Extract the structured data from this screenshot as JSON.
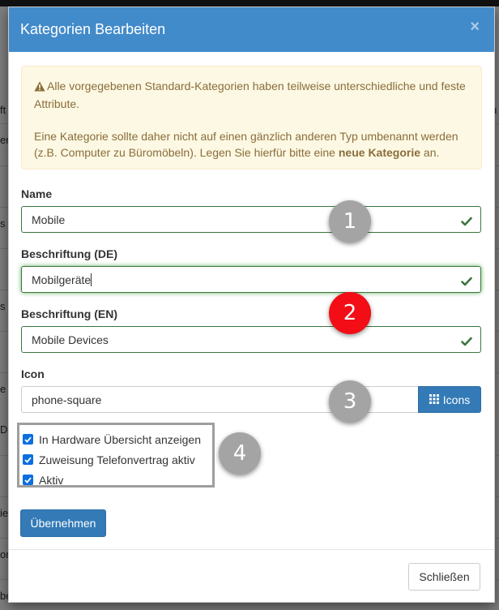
{
  "background": {
    "fragments": [
      "ft",
      "er",
      "s",
      "s",
      "e",
      "De",
      "ie",
      "on",
      "be",
      "u"
    ]
  },
  "modal": {
    "title": "Kategorien Bearbeiten",
    "close_glyph": "×",
    "alert": {
      "line1": "Alle vorgegebenen Standard-Kategorien haben teilweise unterschiedliche und feste Attribute.",
      "line2_prefix": "Eine Kategorie sollte daher nicht auf einen gänzlich anderen Typ umbenannt werden (z.B. Computer zu Büromöbeln). Legen Sie hierfür bitte eine ",
      "line2_bold": "neue Kategorie",
      "line2_suffix": " an."
    },
    "fields": {
      "name": {
        "label": "Name",
        "value": "Mobile"
      },
      "label_de": {
        "label": "Beschriftung (DE)",
        "value": "Mobilgeräte"
      },
      "label_en": {
        "label": "Beschriftung (EN)",
        "value": "Mobile Devices"
      },
      "icon": {
        "label": "Icon",
        "value": "phone-square",
        "button_label": "Icons"
      }
    },
    "checkboxes": [
      {
        "label": "In Hardware Übersicht anzeigen",
        "checked": true
      },
      {
        "label": "Zuweisung Telefonvertrag aktiv",
        "checked": true
      },
      {
        "label": "Aktiv",
        "checked": true
      }
    ],
    "submit_label": "Übernehmen",
    "close_label": "Schließen"
  },
  "markers": [
    "1",
    "2",
    "3",
    "4"
  ],
  "colors": {
    "header": "#428bca",
    "primary": "#337ab7",
    "success": "#3c763d",
    "warning_bg": "#fcf8e3",
    "warning_text": "#8a6d3b",
    "marker_gray": "#a4a4a4",
    "marker_red": "#f30d16"
  }
}
